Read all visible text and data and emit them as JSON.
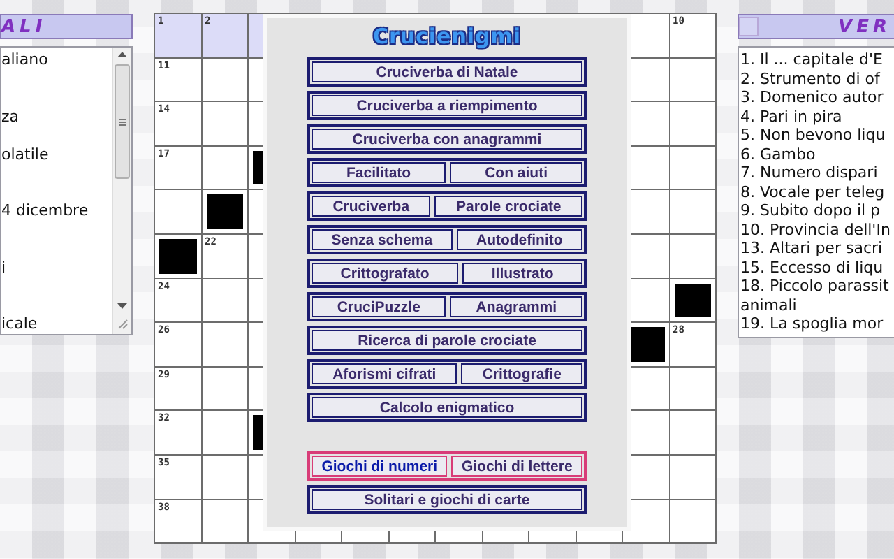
{
  "left_panel": {
    "title": "ALI",
    "items": [
      "aliano",
      "za",
      "olatile",
      "4 dicembre",
      "i",
      "icale"
    ]
  },
  "grid": {
    "rows": [
      {
        "left": [
          {
            "number": "1",
            "black": false,
            "highlighted": true
          },
          {
            "number": "2",
            "black": false,
            "highlighted": true
          },
          {
            "black": false,
            "highlighted": true
          }
        ],
        "right": [
          {
            "black": false,
            "highlighted": false
          },
          {
            "number": "10",
            "black": false,
            "highlighted": false
          }
        ]
      },
      {
        "left": [
          {
            "number": "11",
            "black": false,
            "highlighted": false
          },
          {
            "black": false,
            "highlighted": false
          },
          {
            "black": false,
            "highlighted": false
          }
        ],
        "right": [
          {
            "black": false,
            "highlighted": false
          },
          {
            "black": false,
            "highlighted": false
          }
        ]
      },
      {
        "left": [
          {
            "number": "14",
            "black": false,
            "highlighted": false
          },
          {
            "black": false,
            "highlighted": false
          },
          {
            "black": false,
            "highlighted": false
          }
        ],
        "right": [
          {
            "black": false,
            "highlighted": false
          },
          {
            "black": false,
            "highlighted": false
          }
        ]
      },
      {
        "left": [
          {
            "number": "17",
            "black": false,
            "highlighted": false
          },
          {
            "black": false,
            "highlighted": false
          },
          {
            "black": true,
            "highlighted": false
          }
        ],
        "right": [
          {
            "black": false,
            "highlighted": false
          },
          {
            "black": false,
            "highlighted": false
          }
        ]
      },
      {
        "left": [
          {
            "black": false,
            "highlighted": false
          },
          {
            "black": true,
            "highlighted": false
          },
          {
            "black": false,
            "highlighted": false
          }
        ],
        "right": [
          {
            "black": false,
            "highlighted": false
          },
          {
            "black": false,
            "highlighted": false
          }
        ]
      },
      {
        "left": [
          {
            "black": true,
            "highlighted": false
          },
          {
            "number": "22",
            "black": false,
            "highlighted": false
          },
          {
            "black": false,
            "highlighted": false
          }
        ],
        "right": [
          {
            "black": false,
            "highlighted": false
          },
          {
            "black": false,
            "highlighted": false
          }
        ]
      },
      {
        "left": [
          {
            "number": "24",
            "black": false,
            "highlighted": false
          },
          {
            "black": false,
            "highlighted": false
          },
          {
            "black": false,
            "highlighted": false
          }
        ],
        "right": [
          {
            "black": false,
            "highlighted": false
          },
          {
            "black": true,
            "highlighted": false
          }
        ]
      },
      {
        "left": [
          {
            "number": "26",
            "black": false,
            "highlighted": false
          },
          {
            "black": false,
            "highlighted": false
          },
          {
            "black": false,
            "highlighted": false
          }
        ],
        "right": [
          {
            "black": true,
            "highlighted": false
          },
          {
            "number": "28",
            "black": false,
            "highlighted": false
          }
        ]
      },
      {
        "left": [
          {
            "number": "29",
            "black": false,
            "highlighted": false
          },
          {
            "black": false,
            "highlighted": false
          },
          {
            "black": false,
            "highlighted": false
          }
        ],
        "right": [
          {
            "black": false,
            "highlighted": false
          },
          {
            "black": false,
            "highlighted": false
          }
        ]
      },
      {
        "left": [
          {
            "number": "32",
            "black": false,
            "highlighted": false
          },
          {
            "black": false,
            "highlighted": false
          },
          {
            "black": true,
            "highlighted": false
          }
        ],
        "right": [
          {
            "black": false,
            "highlighted": false
          },
          {
            "black": false,
            "highlighted": false
          }
        ]
      },
      {
        "left": [
          {
            "number": "35",
            "black": false,
            "highlighted": false
          },
          {
            "black": false,
            "highlighted": false
          },
          {
            "black": false,
            "highlighted": false
          }
        ],
        "right": [
          {
            "black": false,
            "highlighted": false
          },
          {
            "black": false,
            "highlighted": false
          }
        ]
      },
      {
        "left": [
          {
            "number": "38",
            "black": false,
            "highlighted": false
          },
          {
            "black": false,
            "highlighted": false
          },
          {
            "black": false,
            "highlighted": false
          }
        ],
        "right": [
          {
            "black": false,
            "highlighted": false
          },
          {
            "black": false,
            "highlighted": false
          }
        ]
      }
    ]
  },
  "menu": {
    "title": "Crucienigmi",
    "rows": [
      {
        "highlighted": false,
        "buttons": [
          {
            "label": "Cruciverba di Natale",
            "selected": false
          }
        ]
      },
      {
        "highlighted": false,
        "buttons": [
          {
            "label": "Cruciverba a riempimento",
            "selected": false
          }
        ]
      },
      {
        "highlighted": false,
        "buttons": [
          {
            "label": "Cruciverba con anagrammi",
            "selected": false
          }
        ]
      },
      {
        "highlighted": false,
        "buttons": [
          {
            "label": "Facilitato",
            "selected": false
          },
          {
            "label": "Con aiuti",
            "selected": false
          }
        ]
      },
      {
        "highlighted": false,
        "buttons": [
          {
            "label": "Cruciverba",
            "selected": false
          },
          {
            "label": "Parole crociate",
            "selected": false
          }
        ]
      },
      {
        "highlighted": false,
        "buttons": [
          {
            "label": "Senza schema",
            "selected": false
          },
          {
            "label": "Autodefinito",
            "selected": false
          }
        ]
      },
      {
        "highlighted": false,
        "buttons": [
          {
            "label": "Crittografato",
            "selected": false
          },
          {
            "label": "Illustrato",
            "selected": false
          }
        ]
      },
      {
        "highlighted": false,
        "buttons": [
          {
            "label": "CruciPuzzle",
            "selected": false
          },
          {
            "label": "Anagrammi",
            "selected": false
          }
        ]
      },
      {
        "highlighted": false,
        "buttons": [
          {
            "label": "Ricerca di parole crociate",
            "selected": false
          }
        ]
      },
      {
        "highlighted": false,
        "buttons": [
          {
            "label": "Aforismi cifrati",
            "selected": false
          },
          {
            "label": "Crittografie",
            "selected": false
          }
        ]
      },
      {
        "highlighted": false,
        "buttons": [
          {
            "label": "Calcolo enigmatico",
            "selected": false
          }
        ]
      },
      {
        "highlighted": true,
        "buttons": [
          {
            "label": "Giochi di numeri",
            "selected": true
          },
          {
            "label": "Giochi di lettere",
            "selected": false
          }
        ]
      },
      {
        "highlighted": false,
        "buttons": [
          {
            "label": "Solitari e giochi di carte",
            "selected": false
          }
        ]
      }
    ]
  },
  "right_panel": {
    "title": "VER",
    "items": [
      "1. Il ... capitale d'E",
      "2. Strumento di of",
      "3. Domenico autor",
      "4. Pari in pira",
      "5. Non bevono liqu",
      "6. Gambo",
      "7. Numero dispari",
      "8. Vocale per teleg",
      "9. Subito dopo il p",
      "10. Provincia dell'In",
      "13. Altari per sacri",
      "15. Eccesso di liqu",
      "18. Piccolo parassit",
      "animali",
      "19. La spoglia mor"
    ]
  }
}
